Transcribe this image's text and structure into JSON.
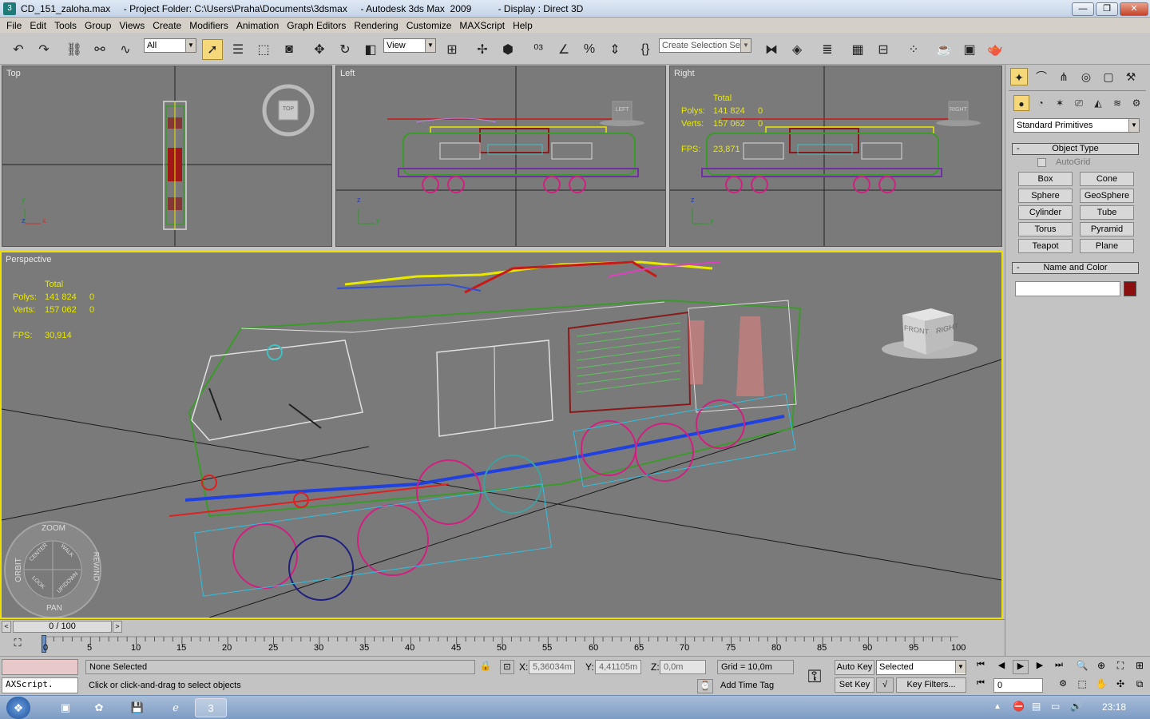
{
  "window": {
    "title": "CD_151_zaloha.max     - Project Folder: C:\\Users\\Praha\\Documents\\3dsmax     - Autodesk 3ds Max  2009          - Display : Direct 3D",
    "minimize": "—",
    "maximize": "❐",
    "close": "✕"
  },
  "menu": [
    "File",
    "Edit",
    "Tools",
    "Group",
    "Views",
    "Create",
    "Modifiers",
    "Animation",
    "Graph Editors",
    "Rendering",
    "Customize",
    "MAXScript",
    "Help"
  ],
  "toolbar": {
    "filter_value": "All",
    "refcoord_value": "View",
    "selection_set_placeholder": "Create Selection Set"
  },
  "viewports": {
    "top": {
      "label": "Top",
      "cube_label": "TOP"
    },
    "left": {
      "label": "Left",
      "cube_label": "LEFT"
    },
    "right": {
      "label": "Right",
      "cube_label": "RIGHT"
    },
    "perspective": {
      "label": "Perspective",
      "cube_front": "FRONT",
      "cube_right": "RIGHT"
    }
  },
  "stats_right": {
    "header": "Total",
    "polys_label": "Polys:",
    "polys_value": "141 824",
    "polys_sel": "0",
    "verts_label": "Verts:",
    "verts_value": "157 062",
    "verts_sel": "0",
    "fps_label": "FPS:",
    "fps_value": "23,871"
  },
  "stats_persp": {
    "header": "Total",
    "polys_label": "Polys:",
    "polys_value": "141 824",
    "polys_sel": "0",
    "verts_label": "Verts:",
    "verts_value": "157 062",
    "verts_sel": "0",
    "fps_label": "FPS:",
    "fps_value": "30,914"
  },
  "axes": {
    "x": "x",
    "y": "y",
    "z": "z"
  },
  "steering_wheel": {
    "zoom": "ZOOM",
    "orbit": "ORBIT",
    "pan": "PAN",
    "rewind": "REWIND",
    "center": "CENTER",
    "walk": "WALK",
    "look": "LOOK",
    "updown": "UP/DOWN"
  },
  "command_panel": {
    "category_value": "Standard Primitives",
    "object_type_title": "Object Type",
    "autogrid_label": "AutoGrid",
    "buttons": [
      "Box",
      "Cone",
      "Sphere",
      "GeoSphere",
      "Cylinder",
      "Tube",
      "Torus",
      "Pyramid",
      "Teapot",
      "Plane"
    ],
    "name_color_title": "Name and Color",
    "name_value": "",
    "object_color": "#8b0f0f"
  },
  "timeline": {
    "slider_text": "0 / 100",
    "ticks": [
      "0",
      "5",
      "10",
      "15",
      "20",
      "25",
      "30",
      "35",
      "40",
      "45",
      "50",
      "55",
      "60",
      "65",
      "70",
      "75",
      "80",
      "85",
      "90",
      "95",
      "100"
    ]
  },
  "status": {
    "maxscript_label": "AXScript.",
    "selection_text": "None Selected",
    "prompt_text": "Click or click-and-drag to select objects",
    "x_label": "X:",
    "x_value": "5,36034m",
    "y_label": "Y:",
    "y_value": "4,41105m",
    "z_label": "Z:",
    "z_value": "0,0m",
    "grid_text": "Grid = 10,0m",
    "add_time_tag": "Add Time Tag",
    "auto_key": "Auto Key",
    "set_key": "Set Key",
    "key_mode_value": "Selected",
    "key_filters": "Key Filters...",
    "frame_value": "0"
  },
  "taskbar": {
    "clock": "23:18"
  }
}
